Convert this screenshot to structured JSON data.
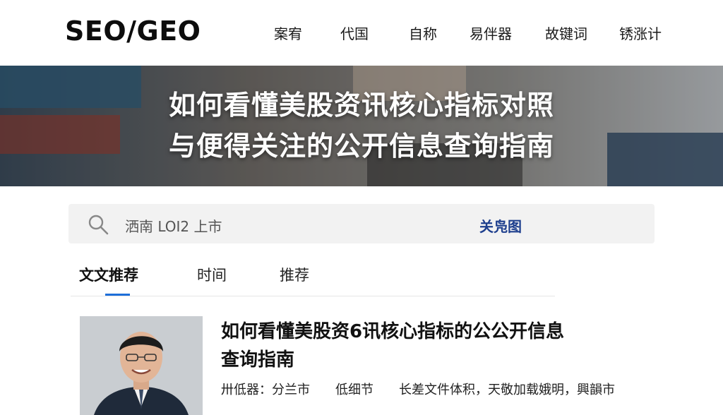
{
  "header": {
    "logo": "SEO/GEO",
    "nav": [
      "案宥",
      "代国",
      "自称",
      "易伴器",
      "故键词",
      "锈涨计"
    ]
  },
  "hero": {
    "line1": "如何看懂美股资讯核心指标对照",
    "line2": "与便得关注的公开信息查询指南"
  },
  "search": {
    "query": "洒南 LOI2 上市",
    "button_label": "关凫图",
    "icon": "search-icon"
  },
  "tabs": {
    "items": [
      "文文推荐",
      "时间",
      "推荐"
    ],
    "active": 0
  },
  "article": {
    "title_line1": "如何看懂美股资6讯核心指标的公公开信息",
    "title_line2": "查询指南",
    "meta_line1": "卅低器：分兰市　　低细节　　长差文件体积，天敬加载娥明，興韻市",
    "meta_line2": "",
    "thumbnail": "person-photo"
  }
}
